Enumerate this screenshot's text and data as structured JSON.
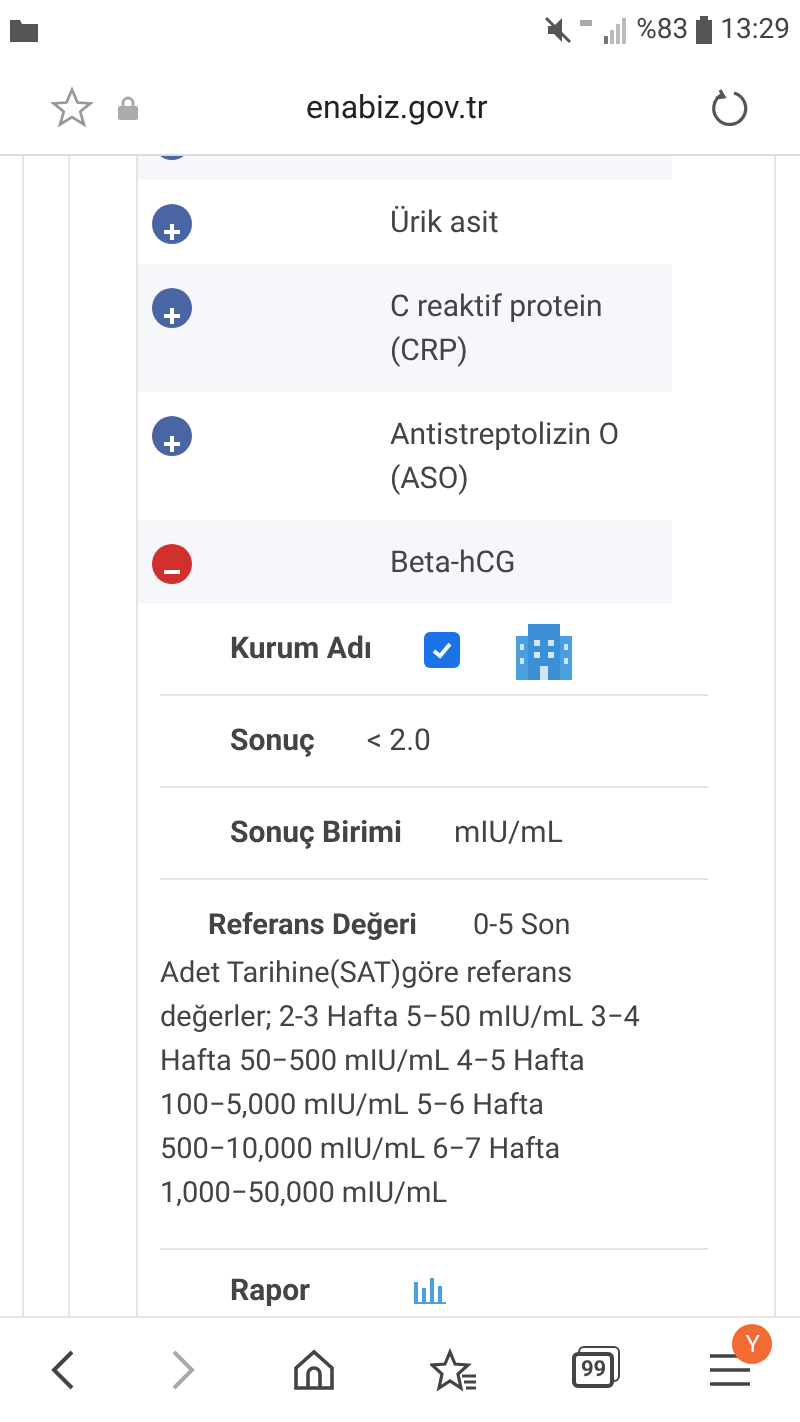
{
  "status_bar": {
    "battery": "%83",
    "time": "13:29"
  },
  "address_bar": {
    "url": "enabiz.gov.tr"
  },
  "tests": [
    {
      "expanded": false
    },
    {
      "name": "Ürik asit",
      "expanded": false
    },
    {
      "name": "C reaktif protein (CRP)",
      "expanded": false
    },
    {
      "name": "Antistreptolizin O (ASO)",
      "expanded": false
    },
    {
      "name": "Beta-hCG",
      "expanded": true
    }
  ],
  "details": [
    {
      "kind": "institution",
      "label": "Kurum Adı",
      "checked": true
    },
    {
      "kind": "text",
      "label": "Sonuç",
      "value": "< 2.0"
    },
    {
      "kind": "text",
      "label": "Sonuç Birimi",
      "value": "mIU/mL"
    },
    {
      "kind": "text",
      "label": "Referans Değeri",
      "value": "0-5 Son",
      "value_continued": "Adet Tarihine(SAT)göre referans değerler; 2-3 Hafta 5−50 mIU/mL 3−4 Hafta 50−500 mIU/mL 4−5 Hafta 100−5,000 mIU/mL 5−6 Hafta 500−10,000 mIU/mL 6−7 Hafta 1,000−50,000 mIU/mL"
    },
    {
      "kind": "report",
      "label": "Rapor"
    }
  ],
  "bottom_nav": {
    "tabs_count": "99",
    "profile_badge": "Y"
  }
}
